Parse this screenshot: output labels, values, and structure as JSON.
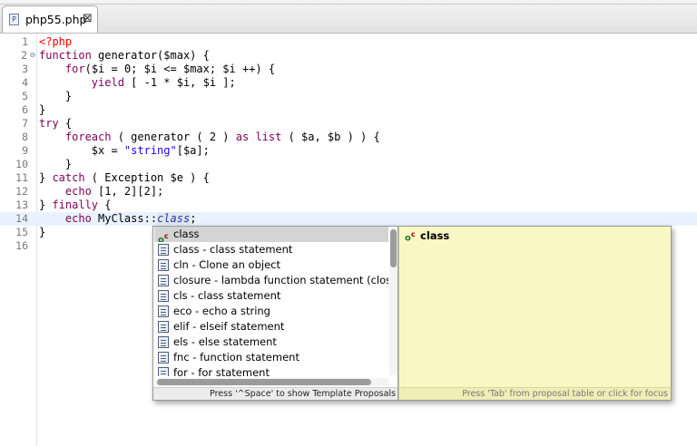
{
  "tab": {
    "label": "php55.php",
    "icon": "php-file-icon",
    "close_glyph": "⊠"
  },
  "editor": {
    "lines": [
      {
        "num": "1",
        "fold": ""
      },
      {
        "num": "2",
        "fold": "⊖"
      },
      {
        "num": "3",
        "fold": ""
      },
      {
        "num": "4",
        "fold": ""
      },
      {
        "num": "5",
        "fold": ""
      },
      {
        "num": "6",
        "fold": ""
      },
      {
        "num": "7",
        "fold": ""
      },
      {
        "num": "8",
        "fold": ""
      },
      {
        "num": "9",
        "fold": ""
      },
      {
        "num": "10",
        "fold": ""
      },
      {
        "num": "11",
        "fold": ""
      },
      {
        "num": "12",
        "fold": ""
      },
      {
        "num": "13",
        "fold": ""
      },
      {
        "num": "14",
        "fold": ""
      },
      {
        "num": "15",
        "fold": ""
      },
      {
        "num": "16",
        "fold": ""
      }
    ],
    "code": {
      "l1": "<?php",
      "l2_kw": "function",
      "l2_rest": " generator($max) {",
      "l3_kw": "for",
      "l3_rest": "($i = 0; $i <= $max; $i ++) {",
      "l4_kw": "yield",
      "l4_rest": " [ -1 * $i, $i ];",
      "l5": "}",
      "l6": "}",
      "l7_kw": "try",
      "l7_rest": " {",
      "l8_kw1": "foreach",
      "l8_mid": " ( generator ( 2 ) ",
      "l8_kw2": "as",
      "l8_sp": " ",
      "l8_kw3": "list",
      "l8_rest": " ( $a, $b ) ) {",
      "l9_a": "$x = ",
      "l9_str": "\"string\"",
      "l9_b": "[$a];",
      "l10": "}",
      "l11_a": "} ",
      "l11_kw": "catch",
      "l11_rest": " ( Exception $e ) {",
      "l12_kw": "echo",
      "l12_rest": " [1, 2][2];",
      "l13_a": "} ",
      "l13_kw": "finally",
      "l13_rest": " {",
      "l14_kw": "echo",
      "l14_a": " MyClass::",
      "l14_it": "class",
      "l14_b": ";",
      "l15": "}"
    }
  },
  "completion": {
    "items": [
      {
        "label": "class",
        "icon": "class-keyword-icon"
      },
      {
        "label": "class - class statement",
        "icon": "template-icon"
      },
      {
        "label": "cln - Clone an object",
        "icon": "template-icon"
      },
      {
        "label": "closure - lambda function statement (closur",
        "icon": "template-icon"
      },
      {
        "label": "cls - class statement",
        "icon": "template-icon"
      },
      {
        "label": "eco - echo a string",
        "icon": "template-icon"
      },
      {
        "label": "elif - elseif statement",
        "icon": "template-icon"
      },
      {
        "label": "els - else statement",
        "icon": "template-icon"
      },
      {
        "label": "fnc - function statement",
        "icon": "template-icon"
      },
      {
        "label": "for - for statement",
        "icon": "template-icon"
      }
    ],
    "list_status": "Press '^Space' to show Template Proposals",
    "info_title": "class",
    "info_status": "Press 'Tab' from proposal table or click for focus"
  },
  "colors": {
    "keyword": "#7f0055",
    "string": "#2a00ff",
    "php_tag": "#ff0000",
    "info_bg": "#f9f7c3",
    "current_line": "#e8f2fe"
  }
}
